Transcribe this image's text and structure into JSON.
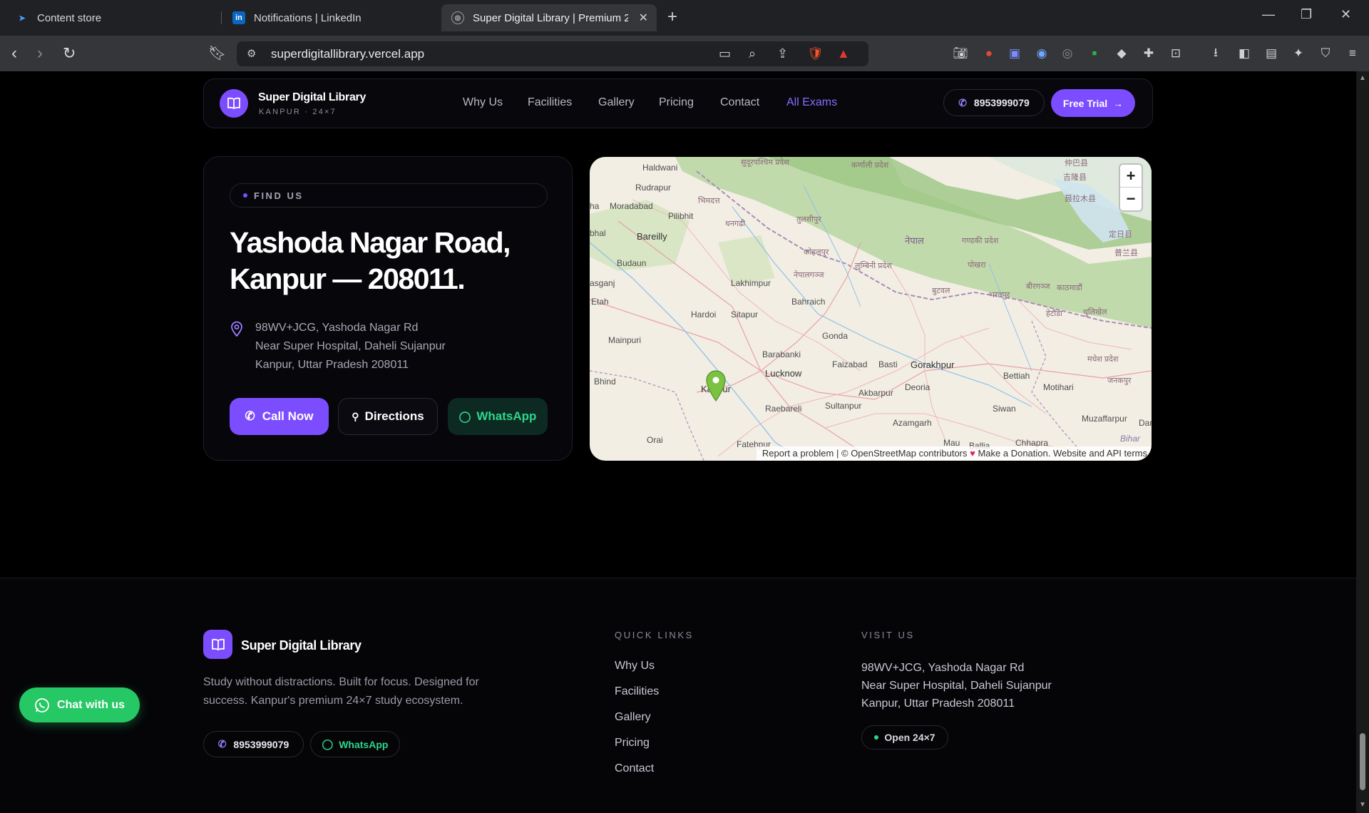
{
  "browser": {
    "tabs": [
      {
        "title": "Content store",
        "favicon": "content-store-icon"
      },
      {
        "title": "Notifications | LinkedIn",
        "favicon": "linkedin-icon"
      },
      {
        "title": "Super Digital Library | Premium 2",
        "favicon": "globe-icon"
      }
    ],
    "url": "superdigitallibrary.vercel.app"
  },
  "nav": {
    "brand": "Super Digital Library",
    "brand_sub": "KANPUR · 24×7",
    "links": [
      "Why Us",
      "Facilities",
      "Gallery",
      "Pricing",
      "Contact",
      "All Exams"
    ],
    "phone": "8953999079",
    "cta": "Free Trial"
  },
  "findus": {
    "eyebrow": "FIND US",
    "title_line1": "Yashoda Nagar Road,",
    "title_line2": "Kanpur — 208011.",
    "address": [
      "98WV+JCG, Yashoda Nagar Rd",
      "Near Super Hospital, Daheli Sujanpur",
      "Kanpur, Uttar Pradesh 208011"
    ],
    "buttons": {
      "call": "Call Now",
      "directions": "Directions",
      "whatsapp": "WhatsApp"
    }
  },
  "map": {
    "zoom_in": "+",
    "zoom_out": "−",
    "attribution": {
      "report": "Report a problem",
      "osm": "© OpenStreetMap contributors",
      "donate": "Make a Donation.",
      "terms": "Website and API terms"
    },
    "labels": {
      "haldwani": "Haldwani",
      "rudrapur": "Rudrapur",
      "moradabad": "Moradabad",
      "pilibhit": "Pilibhit",
      "bareilly": "Bareilly",
      "budaun": "Budaun",
      "lakhimpur": "Lakhimpur",
      "hardoi": "Hardoi",
      "sitapur": "Sitapur",
      "bahraich": "Bahraich",
      "gonda": "Gonda",
      "mainpuri": "Mainpuri",
      "etah": "Etah",
      "bhind": "Bhind",
      "barabanki": "Barabanki",
      "lucknow": "Lucknow",
      "faizabad": "Faizabad",
      "basti": "Basti",
      "gorakhpur": "Gorakhpur",
      "deoria": "Deoria",
      "bettiah": "Bettiah",
      "motihari": "Motihari",
      "siwan": "Siwan",
      "muzaffarpur": "Muzaffarpur",
      "kanpur": "Kanpur",
      "raebareli": "Raebareli",
      "sultanpur": "Sultanpur",
      "akbarpur": "Akbarpur",
      "azamgarh": "Azamgarh",
      "orai": "Orai",
      "fatehpur": "Fatehpur",
      "mau": "Mau",
      "chhapra": "Chhapra",
      "ballia": "Ballia",
      "darbhanga": "Darbhan",
      "bihar": "Bihar",
      "nepal": "नेपाल",
      "pokhara": "पोखरा",
      "kathmandu": "काठमाडौं",
      "lumbini": "लुम्बिनी प्रदेश",
      "sudurpashchim": "सुदूरपश्चिम प्रदेश",
      "karnali": "कर्णाली प्रदेश",
      "bheemdatt": "भिमदत्त",
      "dhangadhi": "धनगढी",
      "tulsipur": "तुलसीपुर",
      "kohalpur": "कोहलपुर",
      "nepalgunj": "नेपालगञ्ज",
      "butwal": "बुटवल",
      "bharatpur": "भरतपुर",
      "hetauda": "हेटौडा",
      "dhulikhel": "धुलिखेल",
      "birgunj": "बीरगञ्ज",
      "madhesh": "मधेश प्रदेश",
      "janakpur": "जनकपुर",
      "gandaki": "गण्डकी प्रदेश",
      "tibet1": "吉隆县",
      "tibet2": "聂拉木县",
      "tibet3": "定日县",
      "tibet4": "普兰县",
      "tibet5": "仲巴县",
      "hala": "ha",
      "bhal": "bhal",
      "asganj": "asganj"
    }
  },
  "footer": {
    "brand": "Super Digital Library",
    "tagline": "Study without distractions. Built for focus. Designed for success. Kanpur's premium 24×7 study ecosystem.",
    "phone": "8953999079",
    "whatsapp": "WhatsApp",
    "quick_links_heading": "QUICK LINKS",
    "quick_links": [
      "Why Us",
      "Facilities",
      "Gallery",
      "Pricing",
      "Contact"
    ],
    "visit_heading": "VISIT US",
    "visit_lines": [
      "98WV+JCG, Yashoda Nagar Rd",
      "Near Super Hospital, Daheli Sujanpur",
      "Kanpur, Uttar Pradesh 208011"
    ],
    "open_badge": "Open 24×7"
  },
  "chat": {
    "label": "Chat with us"
  },
  "colors": {
    "accent": "#7c4dff",
    "whatsapp": "#25c865",
    "background": "#000000"
  }
}
